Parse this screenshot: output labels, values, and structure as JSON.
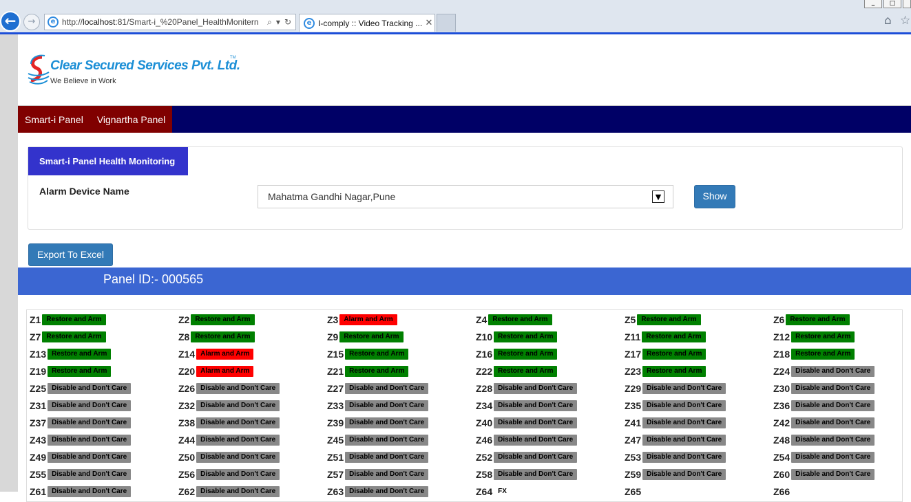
{
  "browser": {
    "url_prefix": "http://",
    "url_host": "localhost",
    "url_rest": ":81/Smart-i_%20Panel_HealthMonitern",
    "tab_title": "I-comply :: Video Tracking ..."
  },
  "header": {
    "company_name": "Clear Secured Services Pvt. Ltd.",
    "tagline": "We Believe in Work"
  },
  "nav": {
    "items": [
      "Smart-i Panel",
      "Vignartha Panel"
    ]
  },
  "form": {
    "tab_title": "Smart-i Panel Health Monitoring",
    "alarm_label": "Alarm Device Name",
    "selected_device": "Mahatma Gandhi Nagar,Pune",
    "show_label": "Show"
  },
  "export_label": "Export To Excel",
  "panel_title": "Panel ID:- 000565",
  "colors": {
    "restore": "#008000",
    "alarm": "#ff0000",
    "disable": "#888888",
    "nav_bg": "#000066",
    "nav_item_bg": "#800000",
    "form_tab_bg": "#3333cc",
    "panel_bar_bg": "#3b66d2"
  },
  "zones": [
    {
      "label": "Z1",
      "status": "Restore and Arm",
      "type": "restore"
    },
    {
      "label": "Z2",
      "status": "Restore and Arm",
      "type": "restore"
    },
    {
      "label": "Z3",
      "status": "Alarm and Arm",
      "type": "alarm"
    },
    {
      "label": "Z4",
      "status": "Restore and Arm",
      "type": "restore"
    },
    {
      "label": "Z5",
      "status": "Restore and Arm",
      "type": "restore"
    },
    {
      "label": "Z6",
      "status": "Restore and Arm",
      "type": "restore"
    },
    {
      "label": "Z7",
      "status": "Restore and Arm",
      "type": "restore"
    },
    {
      "label": "Z8",
      "status": "Restore and Arm",
      "type": "restore"
    },
    {
      "label": "Z9",
      "status": "Restore and Arm",
      "type": "restore"
    },
    {
      "label": "Z10",
      "status": "Restore and Arm",
      "type": "restore"
    },
    {
      "label": "Z11",
      "status": "Restore and Arm",
      "type": "restore"
    },
    {
      "label": "Z12",
      "status": "Restore and Arm",
      "type": "restore"
    },
    {
      "label": "Z13",
      "status": "Restore and Arm",
      "type": "restore"
    },
    {
      "label": "Z14",
      "status": "Alarm and Arm",
      "type": "alarm"
    },
    {
      "label": "Z15",
      "status": "Restore and Arm",
      "type": "restore"
    },
    {
      "label": "Z16",
      "status": "Restore and Arm",
      "type": "restore"
    },
    {
      "label": "Z17",
      "status": "Restore and Arm",
      "type": "restore"
    },
    {
      "label": "Z18",
      "status": "Restore and Arm",
      "type": "restore"
    },
    {
      "label": "Z19",
      "status": "Restore and Arm",
      "type": "restore"
    },
    {
      "label": "Z20",
      "status": "Alarm and Arm",
      "type": "alarm"
    },
    {
      "label": "Z21",
      "status": "Restore and Arm",
      "type": "restore"
    },
    {
      "label": "Z22",
      "status": "Restore and Arm",
      "type": "restore"
    },
    {
      "label": "Z23",
      "status": "Restore and Arm",
      "type": "restore"
    },
    {
      "label": "Z24",
      "status": "Disable and Don't Care",
      "type": "disable"
    },
    {
      "label": "Z25",
      "status": "Disable and Don't Care",
      "type": "disable"
    },
    {
      "label": "Z26",
      "status": "Disable and Don't Care",
      "type": "disable"
    },
    {
      "label": "Z27",
      "status": "Disable and Don't Care",
      "type": "disable"
    },
    {
      "label": "Z28",
      "status": "Disable and Don't Care",
      "type": "disable"
    },
    {
      "label": "Z29",
      "status": "Disable and Don't Care",
      "type": "disable"
    },
    {
      "label": "Z30",
      "status": "Disable and Don't Care",
      "type": "disable"
    },
    {
      "label": "Z31",
      "status": "Disable and Don't Care",
      "type": "disable"
    },
    {
      "label": "Z32",
      "status": "Disable and Don't Care",
      "type": "disable"
    },
    {
      "label": "Z33",
      "status": "Disable and Don't Care",
      "type": "disable"
    },
    {
      "label": "Z34",
      "status": "Disable and Don't Care",
      "type": "disable"
    },
    {
      "label": "Z35",
      "status": "Disable and Don't Care",
      "type": "disable"
    },
    {
      "label": "Z36",
      "status": "Disable and Don't Care",
      "type": "disable"
    },
    {
      "label": "Z37",
      "status": "Disable and Don't Care",
      "type": "disable"
    },
    {
      "label": "Z38",
      "status": "Disable and Don't Care",
      "type": "disable"
    },
    {
      "label": "Z39",
      "status": "Disable and Don't Care",
      "type": "disable"
    },
    {
      "label": "Z40",
      "status": "Disable and Don't Care",
      "type": "disable"
    },
    {
      "label": "Z41",
      "status": "Disable and Don't Care",
      "type": "disable"
    },
    {
      "label": "Z42",
      "status": "Disable and Don't Care",
      "type": "disable"
    },
    {
      "label": "Z43",
      "status": "Disable and Don't Care",
      "type": "disable"
    },
    {
      "label": "Z44",
      "status": "Disable and Don't Care",
      "type": "disable"
    },
    {
      "label": "Z45",
      "status": "Disable and Don't Care",
      "type": "disable"
    },
    {
      "label": "Z46",
      "status": "Disable and Don't Care",
      "type": "disable"
    },
    {
      "label": "Z47",
      "status": "Disable and Don't Care",
      "type": "disable"
    },
    {
      "label": "Z48",
      "status": "Disable and Don't Care",
      "type": "disable"
    },
    {
      "label": "Z49",
      "status": "Disable and Don't Care",
      "type": "disable"
    },
    {
      "label": "Z50",
      "status": "Disable and Don't Care",
      "type": "disable"
    },
    {
      "label": "Z51",
      "status": "Disable and Don't Care",
      "type": "disable"
    },
    {
      "label": "Z52",
      "status": "Disable and Don't Care",
      "type": "disable"
    },
    {
      "label": "Z53",
      "status": "Disable and Don't Care",
      "type": "disable"
    },
    {
      "label": "Z54",
      "status": "Disable and Don't Care",
      "type": "disable"
    },
    {
      "label": "Z55",
      "status": "Disable and Don't Care",
      "type": "disable"
    },
    {
      "label": "Z56",
      "status": "Disable and Don't Care",
      "type": "disable"
    },
    {
      "label": "Z57",
      "status": "Disable and Don't Care",
      "type": "disable"
    },
    {
      "label": "Z58",
      "status": "Disable and Don't Care",
      "type": "disable"
    },
    {
      "label": "Z59",
      "status": "Disable and Don't Care",
      "type": "disable"
    },
    {
      "label": "Z60",
      "status": "Disable and Don't Care",
      "type": "disable"
    },
    {
      "label": "Z61",
      "status": "Disable and Don't Care",
      "type": "disable"
    },
    {
      "label": "Z62",
      "status": "Disable and Don't Care",
      "type": "disable"
    },
    {
      "label": "Z63",
      "status": "Disable and Don't Care",
      "type": "disable"
    },
    {
      "label": "Z64",
      "status": "FX",
      "type": "fx"
    },
    {
      "label": "Z65",
      "status": "",
      "type": "empty"
    },
    {
      "label": "Z66",
      "status": "",
      "type": "empty"
    }
  ]
}
